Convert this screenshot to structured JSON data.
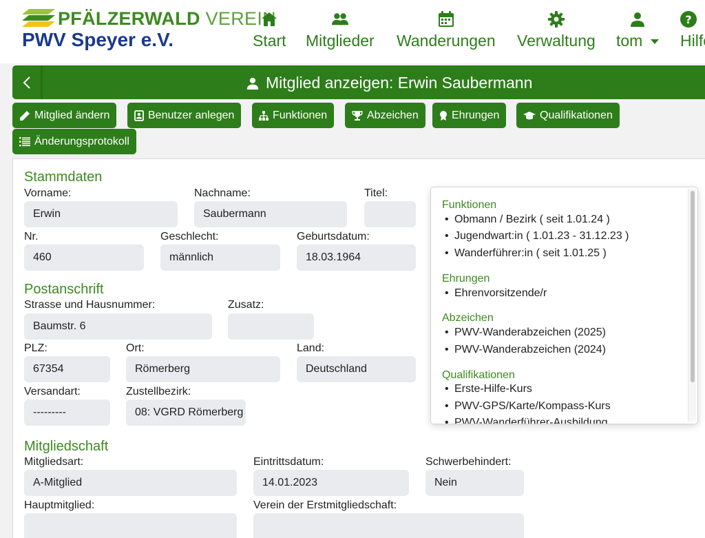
{
  "brand": {
    "top_bold": "PFÄLZERWALD",
    "top_light": "VEREIN",
    "club_name": "PWV Speyer e.V."
  },
  "nav": {
    "start": "Start",
    "members": "Mitglieder",
    "hikes": "Wanderungen",
    "admin": "Verwaltung",
    "user": "tom",
    "help": "Hilfe"
  },
  "page": {
    "title": "Mitglied anzeigen: Erwin Saubermann"
  },
  "actions": {
    "edit": "Mitglied ändern",
    "create_user": "Benutzer anlegen",
    "functions": "Funktionen",
    "badges": "Abzeichen",
    "honors": "Ehrungen",
    "qualifications": "Qualifikationen",
    "changelog": "Änderungsprotokoll"
  },
  "stammdaten": {
    "title": "Stammdaten",
    "vorname_label": "Vorname:",
    "vorname": "Erwin",
    "nachname_label": "Nachname:",
    "nachname": "Saubermann",
    "titel_label": "Titel:",
    "titel": "",
    "nr_label": "Nr.",
    "nr": "460",
    "geschlecht_label": "Geschlecht:",
    "geschlecht": "männlich",
    "geburtsdatum_label": "Geburtsdatum:",
    "geburtsdatum": "18.03.1964"
  },
  "postanschrift": {
    "title": "Postanschrift",
    "strasse_label": "Strasse und Hausnummer:",
    "strasse": "Baumstr. 6",
    "zusatz_label": "Zusatz:",
    "zusatz": "",
    "plz_label": "PLZ:",
    "plz": "67354",
    "ort_label": "Ort:",
    "ort": "Römerberg",
    "land_label": "Land:",
    "land": "Deutschland",
    "versandart_label": "Versandart:",
    "versandart": "---------",
    "zustellbezirk_label": "Zustellbezirk:",
    "zustellbezirk": "08: VGRD Römerberg"
  },
  "mitgliedschaft": {
    "title": "Mitgliedschaft",
    "art_label": "Mitgliedsart:",
    "art": "A-Mitglied",
    "eintritt_label": "Eintrittsdatum:",
    "eintritt": "14.01.2023",
    "schwerbehindert_label": "Schwerbehindert:",
    "schwerbehindert": "Nein",
    "hauptmitglied_label": "Hauptmitglied:",
    "hauptmitglied": "",
    "erstverein_label": "Verein der Erstmitgliedschaft:",
    "erstverein": ""
  },
  "info_panel": {
    "functions_title": "Funktionen",
    "functions": [
      "Obmann / Bezirk ( seit 1.01.24 )",
      "Jugendwart:in ( 1.01.23 - 31.12.23 )",
      "Wanderführer:in ( seit 1.01.25 )"
    ],
    "honors_title": "Ehrungen",
    "honors": [
      "Ehrenvorsitzende/r"
    ],
    "badges_title": "Abzeichen",
    "badges": [
      "PWV-Wanderabzeichen (2025)",
      "PWV-Wanderabzeichen (2024)"
    ],
    "qualifications_title": "Qualifikationen",
    "qualifications": [
      "Erste-Hilfe-Kurs",
      "PWV-GPS/Karte/Kompass-Kurs",
      "PWV-Wanderführer-Ausbildung"
    ]
  },
  "colors": {
    "primary_green": "#2d7d1a",
    "heading_green": "#3c8a1f",
    "brand_blue": "#1a3a8a",
    "field_bg": "#e9ebee"
  },
  "icons": {
    "start": "home-icon",
    "members": "users-icon",
    "hikes": "calendar-icon",
    "admin": "gear-icon",
    "user": "user-icon",
    "help": "question-circle-icon"
  }
}
